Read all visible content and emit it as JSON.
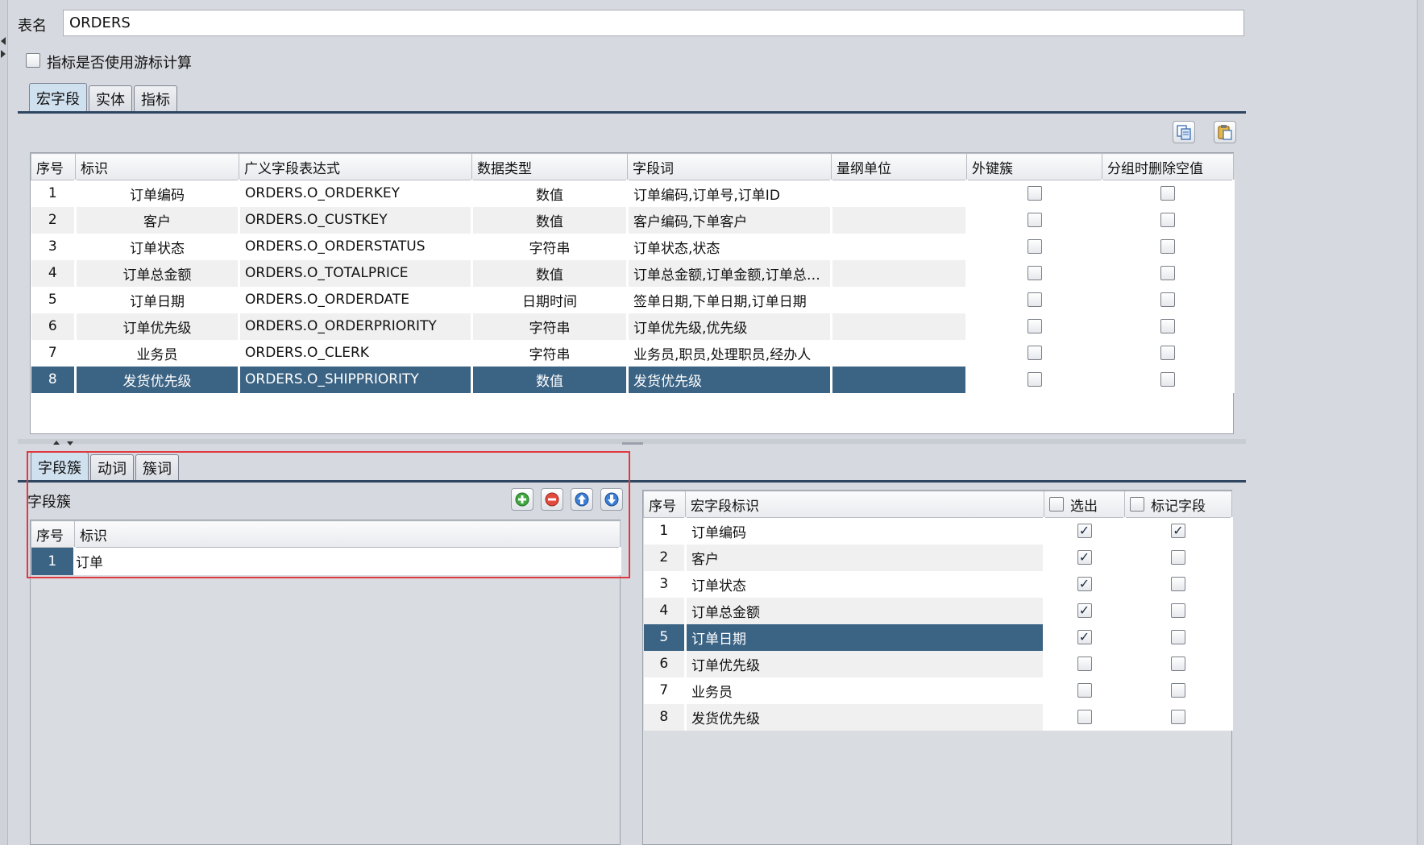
{
  "form": {
    "table_name_label": "表名",
    "table_name_value": "ORDERS",
    "cursor_calc_label": "指标是否使用游标计算"
  },
  "top_tabs": [
    {
      "label": "宏字段",
      "active": true
    },
    {
      "label": "实体",
      "active": false
    },
    {
      "label": "指标",
      "active": false
    }
  ],
  "toolbar_icons": [
    "copy-icon",
    "paste-icon"
  ],
  "macro_table": {
    "headers": [
      "序号",
      "标识",
      "广义字段表达式",
      "数据类型",
      "字段词",
      "量纲单位",
      "外键簇",
      "分组时删除空值"
    ],
    "rows": [
      {
        "no": "1",
        "id": "订单编码",
        "expr": "ORDERS.O_ORDERKEY",
        "type": "数值",
        "words": "订单编码,订单号,订单ID",
        "unit": "",
        "fk": false,
        "del_null": false
      },
      {
        "no": "2",
        "id": "客户",
        "expr": "ORDERS.O_CUSTKEY",
        "type": "数值",
        "words": "客户编码,下单客户",
        "unit": "",
        "fk": false,
        "del_null": false
      },
      {
        "no": "3",
        "id": "订单状态",
        "expr": "ORDERS.O_ORDERSTATUS",
        "type": "字符串",
        "words": "订单状态,状态",
        "unit": "",
        "fk": false,
        "del_null": false
      },
      {
        "no": "4",
        "id": "订单总金额",
        "expr": "ORDERS.O_TOTALPRICE",
        "type": "数值",
        "words": "订单总金额,订单金额,订单总额,...",
        "unit": "",
        "fk": false,
        "del_null": false
      },
      {
        "no": "5",
        "id": "订单日期",
        "expr": "ORDERS.O_ORDERDATE",
        "type": "日期时间",
        "words": "签单日期,下单日期,订单日期",
        "unit": "",
        "fk": false,
        "del_null": false
      },
      {
        "no": "6",
        "id": "订单优先级",
        "expr": "ORDERS.O_ORDERPRIORITY",
        "type": "字符串",
        "words": "订单优先级,优先级",
        "unit": "",
        "fk": false,
        "del_null": false
      },
      {
        "no": "7",
        "id": "业务员",
        "expr": "ORDERS.O_CLERK",
        "type": "字符串",
        "words": "业务员,职员,处理职员,经办人",
        "unit": "",
        "fk": false,
        "del_null": false
      },
      {
        "no": "8",
        "id": "发货优先级",
        "expr": "ORDERS.O_SHIPPRIORITY",
        "type": "数值",
        "words": "发货优先级",
        "unit": "",
        "fk": false,
        "del_null": false
      }
    ],
    "selected_row": 8
  },
  "bottom_tabs": [
    {
      "label": "字段簇",
      "active": true
    },
    {
      "label": "动词",
      "active": false
    },
    {
      "label": "簇词",
      "active": false
    }
  ],
  "cluster": {
    "title": "字段簇",
    "headers": [
      "序号",
      "标识"
    ],
    "rows": [
      {
        "no": "1",
        "id": "订单"
      }
    ],
    "buttons": [
      "add-icon",
      "remove-icon",
      "move-up-icon",
      "move-down-icon"
    ]
  },
  "macro_select": {
    "headers": [
      "序号",
      "宏字段标识",
      "选出",
      "标记字段"
    ],
    "rows": [
      {
        "no": "1",
        "id": "订单编码",
        "selected": true,
        "marked": true
      },
      {
        "no": "2",
        "id": "客户",
        "selected": true,
        "marked": false
      },
      {
        "no": "3",
        "id": "订单状态",
        "selected": true,
        "marked": false
      },
      {
        "no": "4",
        "id": "订单总金额",
        "selected": true,
        "marked": false
      },
      {
        "no": "5",
        "id": "订单日期",
        "selected": true,
        "marked": false
      },
      {
        "no": "6",
        "id": "订单优先级",
        "selected": false,
        "marked": false
      },
      {
        "no": "7",
        "id": "业务员",
        "selected": false,
        "marked": false
      },
      {
        "no": "8",
        "id": "发货优先级",
        "selected": false,
        "marked": false
      }
    ],
    "selected_row": 5
  },
  "colors": {
    "selection": "#3b6384",
    "tab_underline": "#2e4660",
    "highlight_frame": "#e0393f"
  }
}
